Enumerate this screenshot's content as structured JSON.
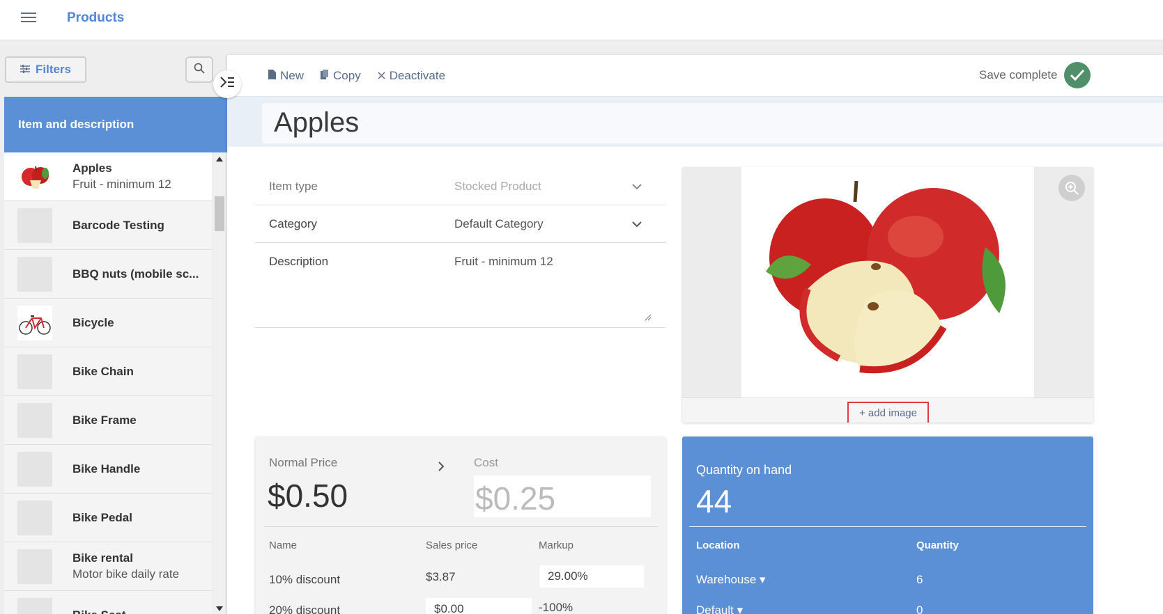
{
  "app": {
    "title": "Products"
  },
  "sidebar": {
    "filters_label": "Filters",
    "list_header": "Item and description",
    "items": [
      {
        "name": "Apples",
        "desc": "Fruit - minimum 12",
        "thumb": "apple"
      },
      {
        "name": "Barcode Testing",
        "desc": "",
        "thumb": ""
      },
      {
        "name": "BBQ nuts (mobile sc...",
        "desc": "",
        "thumb": ""
      },
      {
        "name": "Bicycle",
        "desc": "",
        "thumb": "bicycle"
      },
      {
        "name": "Bike Chain",
        "desc": "",
        "thumb": ""
      },
      {
        "name": "Bike Frame",
        "desc": "",
        "thumb": ""
      },
      {
        "name": "Bike Handle",
        "desc": "",
        "thumb": ""
      },
      {
        "name": "Bike Pedal",
        "desc": "",
        "thumb": ""
      },
      {
        "name": "Bike rental",
        "desc": "Motor bike daily rate",
        "thumb": ""
      },
      {
        "name": "Bike Seat",
        "desc": "",
        "thumb": ""
      }
    ]
  },
  "toolbar": {
    "new_label": "New",
    "copy_label": "Copy",
    "deactivate_label": "Deactivate",
    "save_status": "Save complete"
  },
  "product": {
    "title": "Apples",
    "fields": {
      "item_type_label": "Item type",
      "item_type_value": "Stocked Product",
      "category_label": "Category",
      "category_value": "Default Category",
      "description_label": "Description",
      "description_value": "Fruit - minimum 12"
    },
    "image": {
      "add_label": "+ add image"
    }
  },
  "pricing": {
    "normal_price_label": "Normal Price",
    "normal_price": "$0.50",
    "cost_label": "Cost",
    "cost": "$0.25",
    "headers": {
      "name": "Name",
      "sales_price": "Sales price",
      "markup": "Markup"
    },
    "rows": [
      {
        "name": "10% discount",
        "sales_price": "$3.87",
        "markup": "29.00%"
      },
      {
        "name": "20% discount",
        "sales_price": "$0.00",
        "markup": "-100%"
      }
    ]
  },
  "quantity": {
    "label": "Quantity on hand",
    "value": "44",
    "headers": {
      "location": "Location",
      "quantity": "Quantity"
    },
    "rows": [
      {
        "location": "Warehouse ▾",
        "quantity": "6"
      },
      {
        "location": "Default ▾",
        "quantity": "0"
      }
    ]
  },
  "colors": {
    "accent": "#5b8fd6",
    "brand_text": "#4f86d6",
    "success": "#4f8f6a",
    "highlight_border": "#e03a3a"
  }
}
